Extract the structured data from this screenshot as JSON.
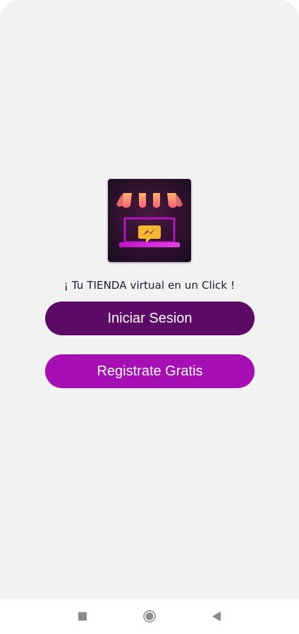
{
  "app": {
    "logo_icon": "storefront-chat-icon",
    "tagline": "¡ Tu TIENDA virtual en un Click !"
  },
  "buttons": {
    "login_label": "Iniciar Sesion",
    "register_label": "Registrate Gratis"
  },
  "navbar": {
    "items": [
      {
        "icon": "recent-apps-icon"
      },
      {
        "icon": "home-icon"
      },
      {
        "icon": "back-icon"
      }
    ]
  },
  "colors": {
    "background": "#f2f2f3",
    "login_button": "#5c0a66",
    "register_button": "#a60fb3",
    "text_dark": "#1a1a2e"
  }
}
